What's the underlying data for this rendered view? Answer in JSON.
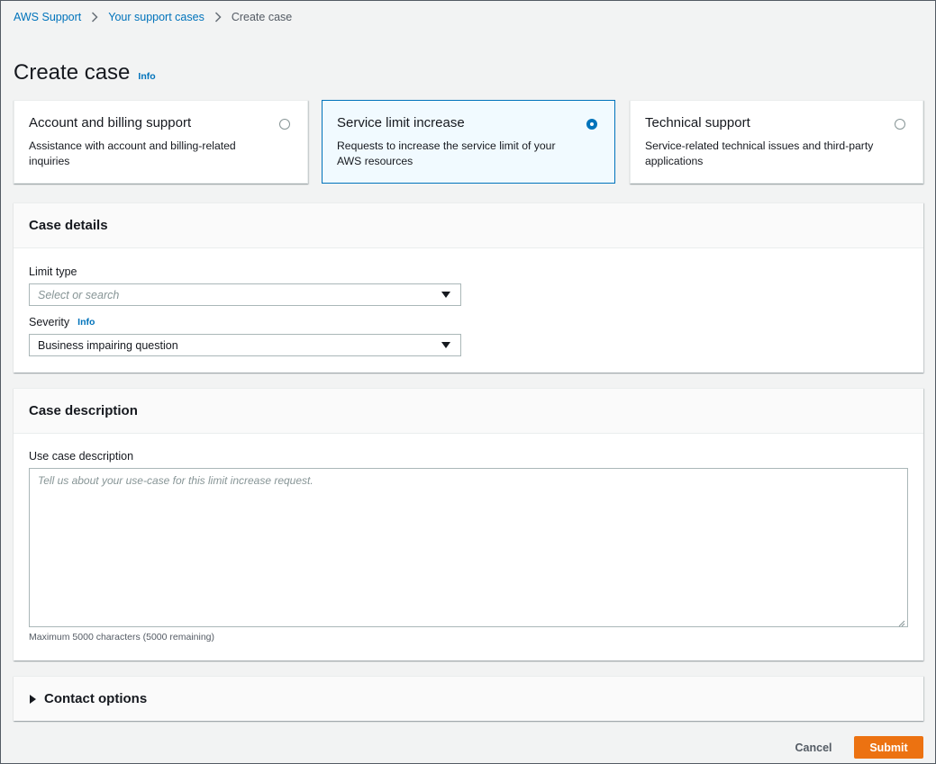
{
  "breadcrumb": {
    "items": [
      "AWS Support",
      "Your support cases",
      "Create case"
    ]
  },
  "page": {
    "title": "Create case",
    "info": "Info"
  },
  "case_types": [
    {
      "title": "Account and billing support",
      "description": "Assistance with account and billing-related inquiries",
      "selected": false
    },
    {
      "title": "Service limit increase",
      "description": "Requests to increase the service limit of your AWS resources",
      "selected": true
    },
    {
      "title": "Technical support",
      "description": "Service-related technical issues and third-party applications",
      "selected": false
    }
  ],
  "case_details": {
    "heading": "Case details",
    "limit_type": {
      "label": "Limit type",
      "placeholder": "Select or search"
    },
    "severity": {
      "label": "Severity",
      "info": "Info",
      "value": "Business impairing question"
    }
  },
  "case_description": {
    "heading": "Case description",
    "label": "Use case description",
    "placeholder": "Tell us about your use-case for this limit increase request.",
    "hint": "Maximum 5000 characters (5000 remaining)"
  },
  "contact_options": {
    "heading": "Contact options"
  },
  "actions": {
    "cancel": "Cancel",
    "submit": "Submit"
  },
  "colors": {
    "link": "#0073bb",
    "primary_button": "#ec7211",
    "selected_tile_bg": "#f1faff"
  }
}
